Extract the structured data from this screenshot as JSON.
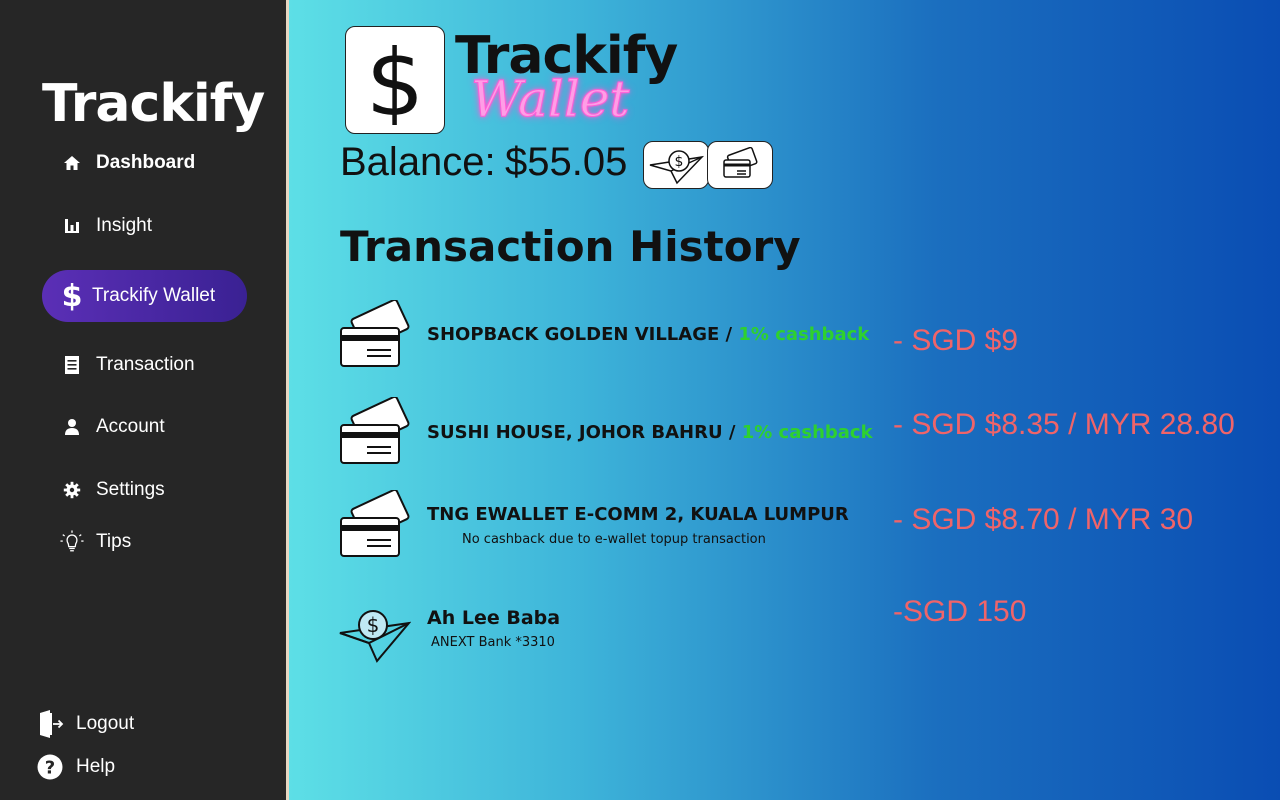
{
  "sidebar": {
    "brand": "Trackify",
    "items": [
      {
        "label": "Dashboard",
        "icon": "home-icon"
      },
      {
        "label": "Insight",
        "icon": "bar-chart-icon"
      },
      {
        "label": "Trackify Wallet",
        "icon": "dollar-icon"
      },
      {
        "label": "Transaction",
        "icon": "receipt-icon"
      },
      {
        "label": "Account",
        "icon": "user-icon"
      },
      {
        "label": "Settings",
        "icon": "gear-icon"
      },
      {
        "label": "Tips",
        "icon": "lightbulb-icon"
      }
    ],
    "logout": "Logout",
    "help": "Help",
    "active_color": "#4a2aa8"
  },
  "header": {
    "title": "Trackify",
    "subtitle": "Wallet",
    "balance_label": "Balance:",
    "balance_value": "$55.05"
  },
  "history": {
    "title": "Transaction History",
    "transactions": [
      {
        "merchant": "SHOPBACK GOLDEN VILLAGE / ",
        "cashback": "1% cashback",
        "note": "",
        "amount": "- SGD $9",
        "icon": "credit-card-icon"
      },
      {
        "merchant": "SUSHI HOUSE, JOHOR BAHRU / ",
        "cashback": "1% cashback",
        "note": "",
        "amount": "- SGD $8.35 / MYR 28.80",
        "icon": "credit-card-icon"
      },
      {
        "merchant": "TNG EWALLET E-COMM 2, KUALA LUMPUR",
        "cashback": "",
        "note": "No cashback due to e-wallet topup transaction",
        "amount": "- SGD $8.70 / MYR 30",
        "icon": "credit-card-icon"
      },
      {
        "merchant": "Ah Lee Baba",
        "cashback": "",
        "note": "ANEXT Bank *3310",
        "amount": "-SGD 150",
        "icon": "paper-plane-dollar-icon"
      }
    ]
  },
  "colors": {
    "cashback": "#2ed12e",
    "amount": "#f06469",
    "sidebar_bg": "#262626"
  }
}
